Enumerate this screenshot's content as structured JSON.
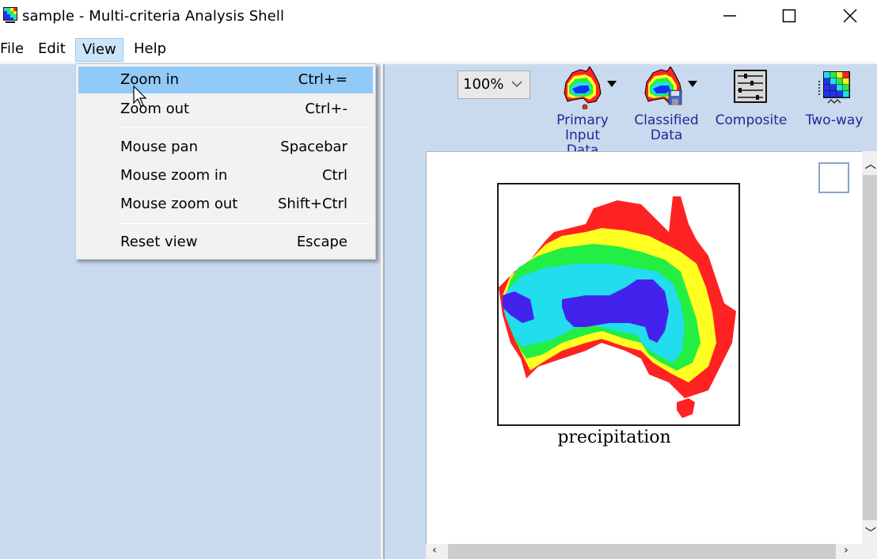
{
  "window": {
    "title": "sample - Multi-criteria Analysis Shell",
    "app_icon": "grid-app-icon",
    "controls": {
      "minimize": "minimize-icon",
      "maximize": "maximize-icon",
      "close": "close-icon"
    }
  },
  "menubar": {
    "items": [
      {
        "label": "File"
      },
      {
        "label": "Edit"
      },
      {
        "label": "View",
        "active": true
      },
      {
        "label": "Help"
      }
    ]
  },
  "view_menu": {
    "items": [
      {
        "label": "Zoom in",
        "shortcut": "Ctrl+=",
        "highlighted": true
      },
      {
        "label": "Zoom out",
        "shortcut": "Ctrl+-"
      },
      {
        "label": "Mouse pan",
        "shortcut": "Spacebar"
      },
      {
        "label": "Mouse zoom in",
        "shortcut": "Ctrl"
      },
      {
        "label": "Mouse zoom out",
        "shortcut": "Shift+Ctrl"
      },
      {
        "label": "Reset view",
        "shortcut": "Escape"
      }
    ]
  },
  "toolbar": {
    "zoom_value": "100%",
    "tools": [
      {
        "label_line1": "Primary",
        "label_line2": "Input Data",
        "icon": "australia-map-icon",
        "has_dropdown": true
      },
      {
        "label_line1": "Classified",
        "label_line2": "Data",
        "icon": "australia-map-save-icon",
        "has_dropdown": true
      },
      {
        "label_line1": "Composite",
        "label_line2": "",
        "icon": "sliders-icon",
        "has_dropdown": false
      },
      {
        "label_line1": "Two-way",
        "label_line2": "",
        "icon": "color-grid-icon",
        "has_dropdown": false
      }
    ]
  },
  "canvas": {
    "map_caption": "precipitation",
    "legend_colors": [
      "#ff2222",
      "#ffff22",
      "#22ee44",
      "#22ddee",
      "#4422ee"
    ]
  }
}
